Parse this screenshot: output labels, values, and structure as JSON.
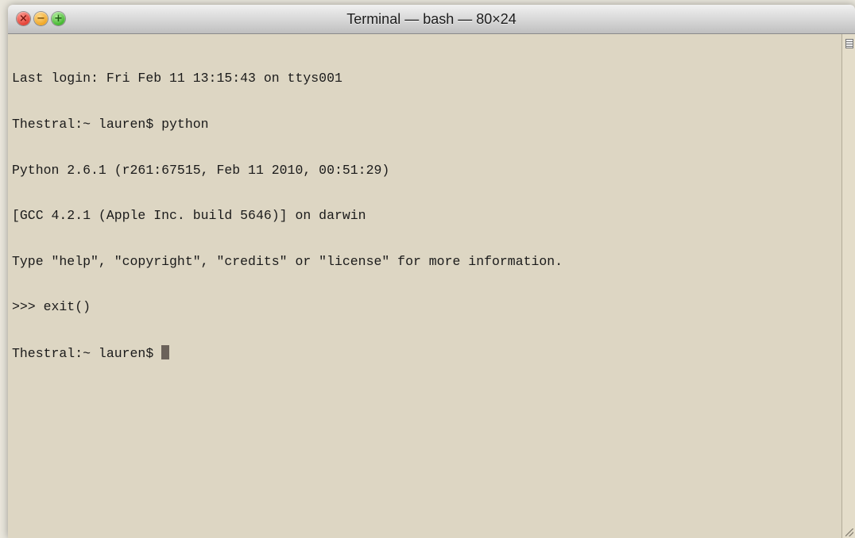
{
  "window": {
    "title": "Terminal — bash — 80×24",
    "close_glyph": "×",
    "minimize_glyph": "−",
    "zoom_glyph": "+",
    "colors": {
      "background": "#ddd6c3",
      "text": "#1a1a1a",
      "cursor": "#6b625a"
    }
  },
  "terminal": {
    "lines": [
      "Last login: Fri Feb 11 13:15:43 on ttys001",
      "Thestral:~ lauren$ python",
      "Python 2.6.1 (r261:67515, Feb 11 2010, 00:51:29)",
      "[GCC 4.2.1 (Apple Inc. build 5646)] on darwin",
      "Type \"help\", \"copyright\", \"credits\" or \"license\" for more information.",
      ">>> exit()"
    ],
    "prompt": "Thestral:~ lauren$ "
  }
}
